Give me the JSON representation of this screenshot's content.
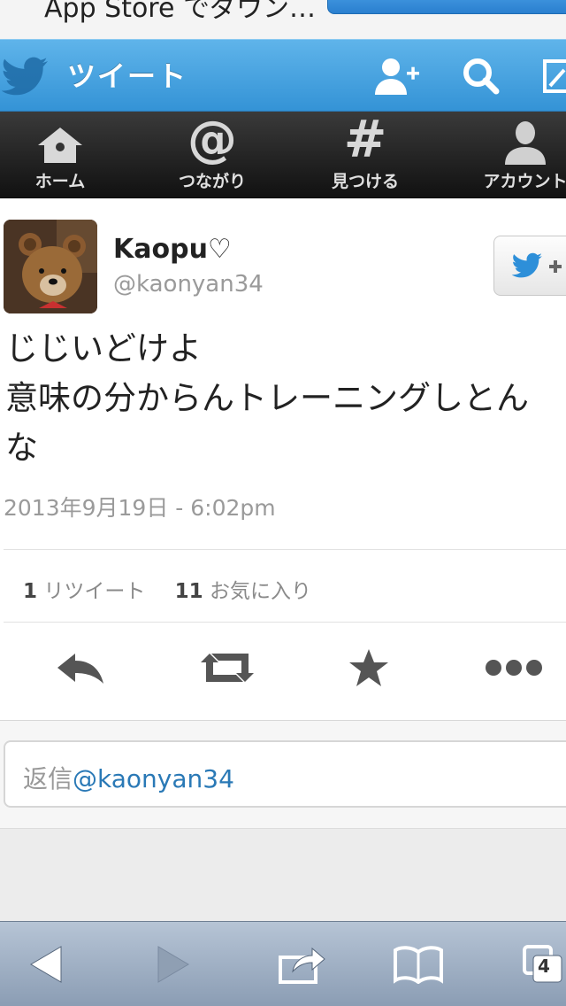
{
  "banner": {
    "text": "App Store でダウン…"
  },
  "header": {
    "title": "ツイート"
  },
  "nav": {
    "items": [
      {
        "label": "ホーム"
      },
      {
        "label": "つながり"
      },
      {
        "label": "見つける"
      },
      {
        "label": "アカウント"
      }
    ]
  },
  "tweet": {
    "name": "Kaopu♡",
    "handle": "@kaonyan34",
    "lines": [
      "じじいどけよ",
      "意味の分からんトレーニングしとん",
      "な"
    ],
    "timestamp": "2013年9月19日 - 6:02pm",
    "retweet_count": "1",
    "retweet_label": "リツイート",
    "favorite_count": "11",
    "favorite_label": "お気に入り"
  },
  "reply": {
    "prefix": "返信",
    "mention": "@kaonyan34"
  },
  "toolbar": {
    "tabs_count": "4"
  },
  "colors": {
    "twitter_blue": "#3493d6",
    "mention_blue": "#2a79b6"
  }
}
